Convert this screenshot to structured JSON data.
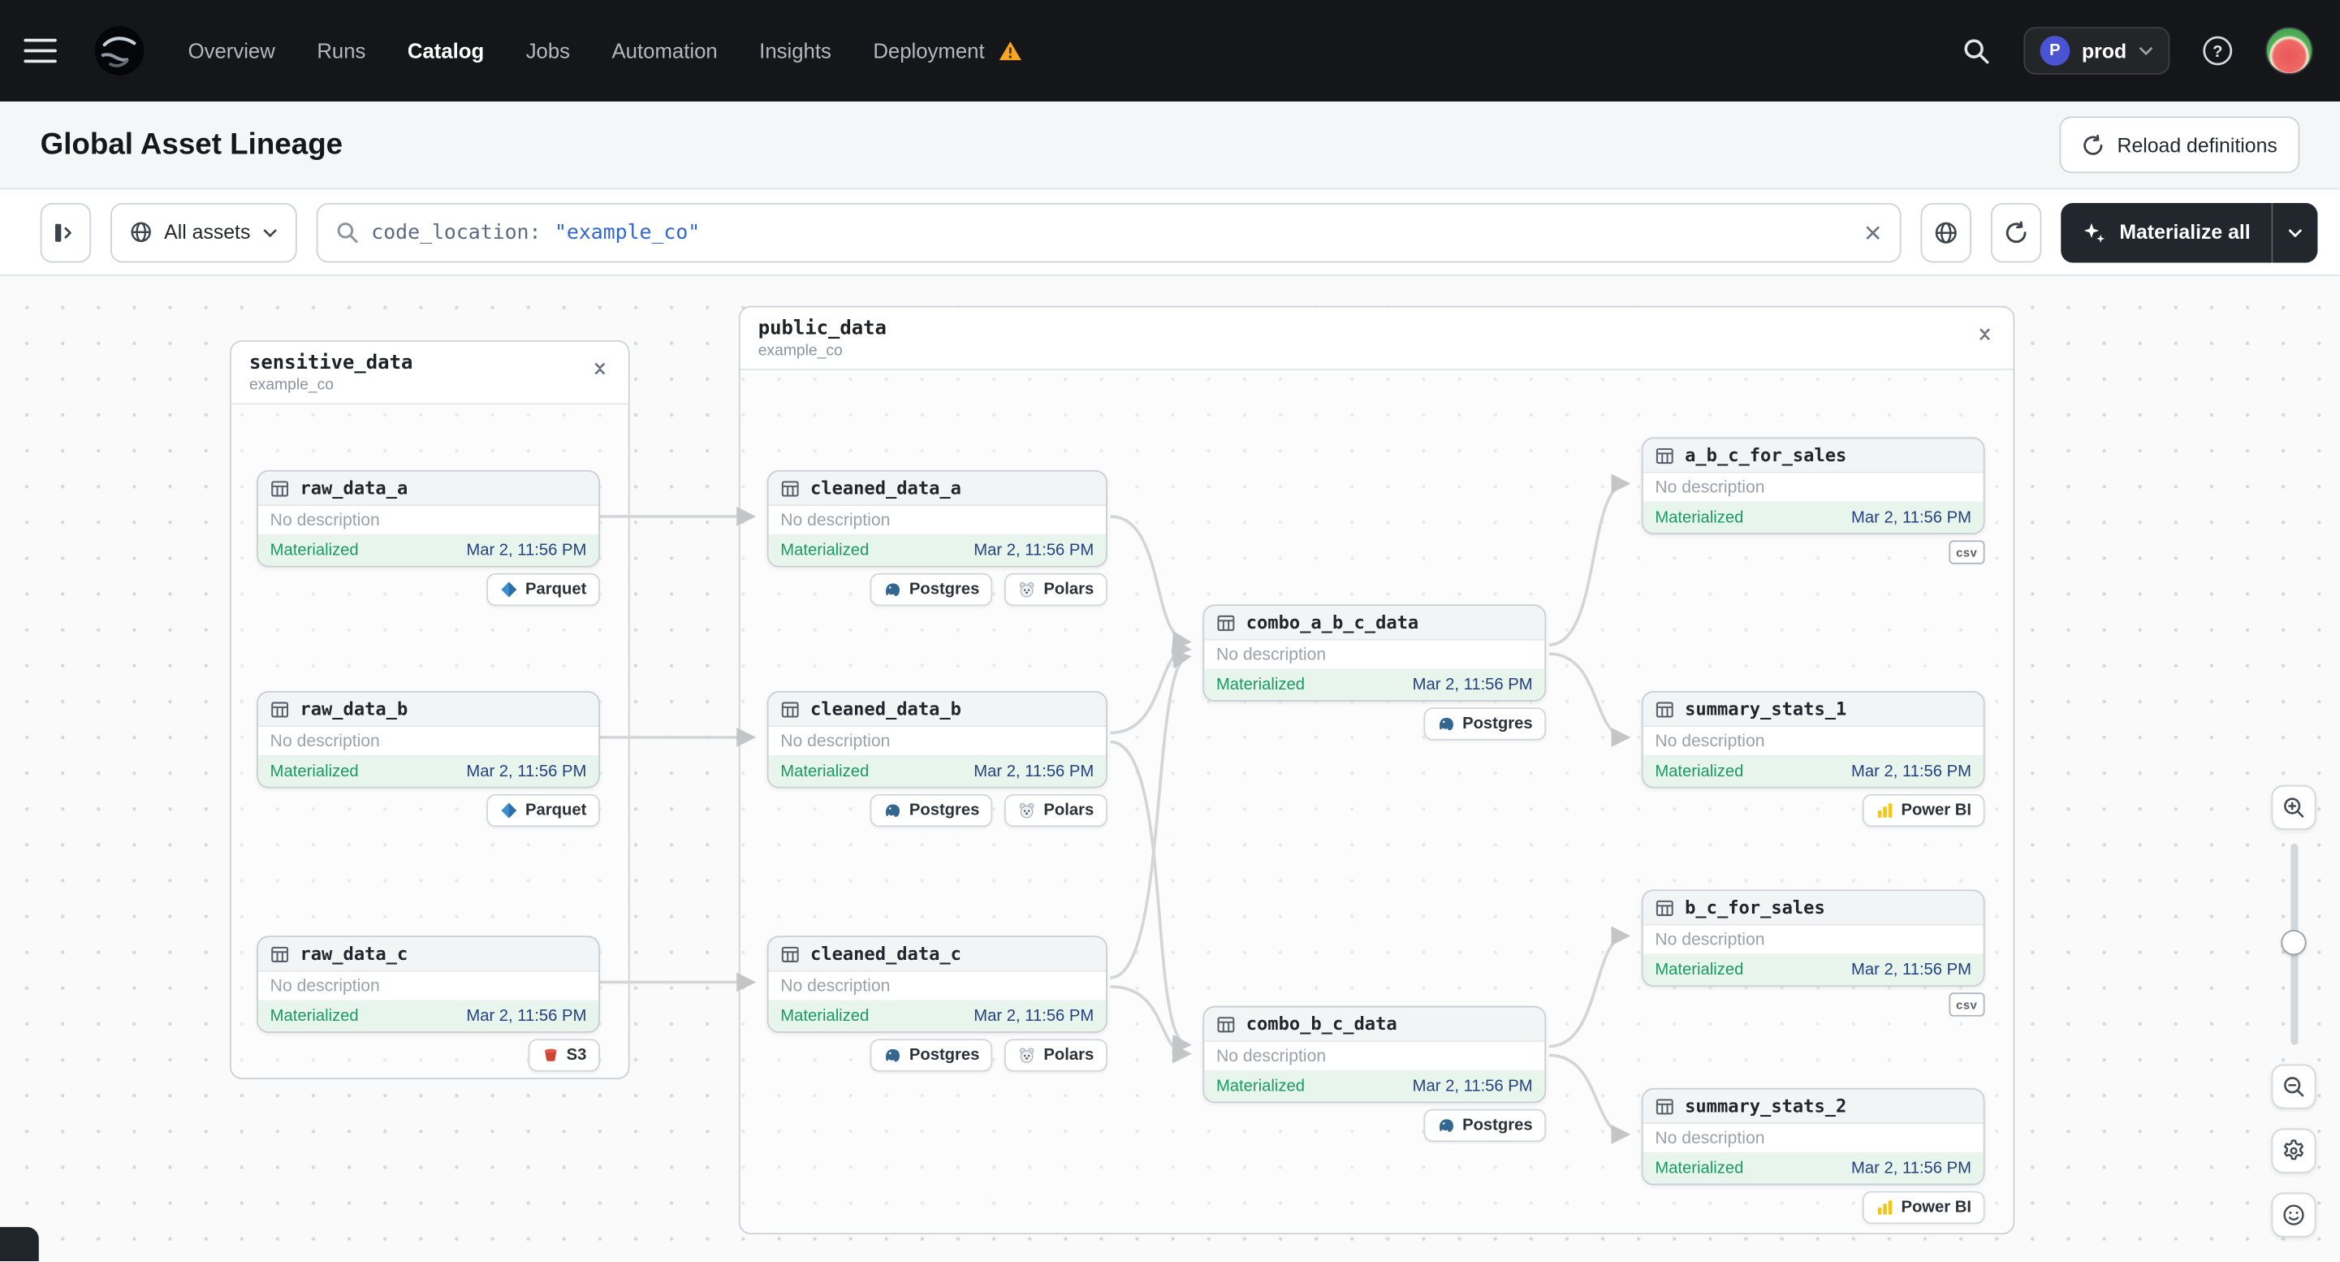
{
  "nav": {
    "items": [
      "Overview",
      "Runs",
      "Catalog",
      "Jobs",
      "Automation",
      "Insights",
      "Deployment"
    ],
    "active": "Catalog",
    "environment_badge": "P",
    "environment": "prod"
  },
  "header": {
    "title": "Global Asset Lineage",
    "reload_label": "Reload definitions"
  },
  "toolbar": {
    "filter_label": "All assets",
    "search_token": "code_location:",
    "search_term": "\"example_co\"",
    "materialize_label": "Materialize all"
  },
  "colors": {
    "nav_bg": "#14161a",
    "materialized_green": "#189a60",
    "status_bg": "#e7f5ec",
    "timestamp_blue": "#24417e",
    "warning_orange": "#F5A623",
    "search_term_blue": "#2f66d0"
  },
  "graph": {
    "groups": [
      {
        "name": "sensitive_data",
        "location": "example_co"
      },
      {
        "name": "public_data",
        "location": "example_co"
      }
    ],
    "nodes": [
      {
        "name": "raw_data_a",
        "description": "No description",
        "status": "Materialized",
        "timestamp": "Mar 2, 11:56 PM",
        "tags": [
          {
            "label": "Parquet",
            "icon": "parquet-icon"
          }
        ]
      },
      {
        "name": "raw_data_b",
        "description": "No description",
        "status": "Materialized",
        "timestamp": "Mar 2, 11:56 PM",
        "tags": [
          {
            "label": "Parquet",
            "icon": "parquet-icon"
          }
        ]
      },
      {
        "name": "raw_data_c",
        "description": "No description",
        "status": "Materialized",
        "timestamp": "Mar 2, 11:56 PM",
        "tags": [
          {
            "label": "S3",
            "icon": "s3-icon"
          }
        ]
      },
      {
        "name": "cleaned_data_a",
        "description": "No description",
        "status": "Materialized",
        "timestamp": "Mar 2, 11:56 PM",
        "tags": [
          {
            "label": "Postgres",
            "icon": "postgres-icon"
          },
          {
            "label": "Polars",
            "icon": "polars-icon"
          }
        ]
      },
      {
        "name": "cleaned_data_b",
        "description": "No description",
        "status": "Materialized",
        "timestamp": "Mar 2, 11:56 PM",
        "tags": [
          {
            "label": "Postgres",
            "icon": "postgres-icon"
          },
          {
            "label": "Polars",
            "icon": "polars-icon"
          }
        ]
      },
      {
        "name": "cleaned_data_c",
        "description": "No description",
        "status": "Materialized",
        "timestamp": "Mar 2, 11:56 PM",
        "tags": [
          {
            "label": "Postgres",
            "icon": "postgres-icon"
          },
          {
            "label": "Polars",
            "icon": "polars-icon"
          }
        ]
      },
      {
        "name": "combo_a_b_c_data",
        "description": "No description",
        "status": "Materialized",
        "timestamp": "Mar 2, 11:56 PM",
        "tags": [
          {
            "label": "Postgres",
            "icon": "postgres-icon"
          }
        ]
      },
      {
        "name": "combo_b_c_data",
        "description": "No description",
        "status": "Materialized",
        "timestamp": "Mar 2, 11:56 PM",
        "tags": [
          {
            "label": "Postgres",
            "icon": "postgres-icon"
          }
        ]
      },
      {
        "name": "a_b_c_for_sales",
        "description": "No description",
        "status": "Materialized",
        "timestamp": "Mar 2, 11:56 PM",
        "file_badge": "csv",
        "tags": []
      },
      {
        "name": "summary_stats_1",
        "description": "No description",
        "status": "Materialized",
        "timestamp": "Mar 2, 11:56 PM",
        "tags": [
          {
            "label": "Power BI",
            "icon": "powerbi-icon"
          }
        ]
      },
      {
        "name": "b_c_for_sales",
        "description": "No description",
        "status": "Materialized",
        "timestamp": "Mar 2, 11:56 PM",
        "file_badge": "csv",
        "tags": []
      },
      {
        "name": "summary_stats_2",
        "description": "No description",
        "status": "Materialized",
        "timestamp": "Mar 2, 11:56 PM",
        "tags": [
          {
            "label": "Power BI",
            "icon": "powerbi-icon"
          }
        ]
      }
    ],
    "edges": [
      {
        "from": "raw_data_a",
        "to": "cleaned_data_a"
      },
      {
        "from": "raw_data_b",
        "to": "cleaned_data_b"
      },
      {
        "from": "raw_data_c",
        "to": "cleaned_data_c"
      },
      {
        "from": "cleaned_data_a",
        "to": "combo_a_b_c_data"
      },
      {
        "from": "cleaned_data_b",
        "to": "combo_a_b_c_data"
      },
      {
        "from": "cleaned_data_c",
        "to": "combo_a_b_c_data"
      },
      {
        "from": "cleaned_data_b",
        "to": "combo_b_c_data"
      },
      {
        "from": "cleaned_data_c",
        "to": "combo_b_c_data"
      },
      {
        "from": "combo_a_b_c_data",
        "to": "a_b_c_for_sales"
      },
      {
        "from": "combo_a_b_c_data",
        "to": "summary_stats_1"
      },
      {
        "from": "combo_b_c_data",
        "to": "b_c_for_sales"
      },
      {
        "from": "combo_b_c_data",
        "to": "summary_stats_2"
      }
    ]
  }
}
